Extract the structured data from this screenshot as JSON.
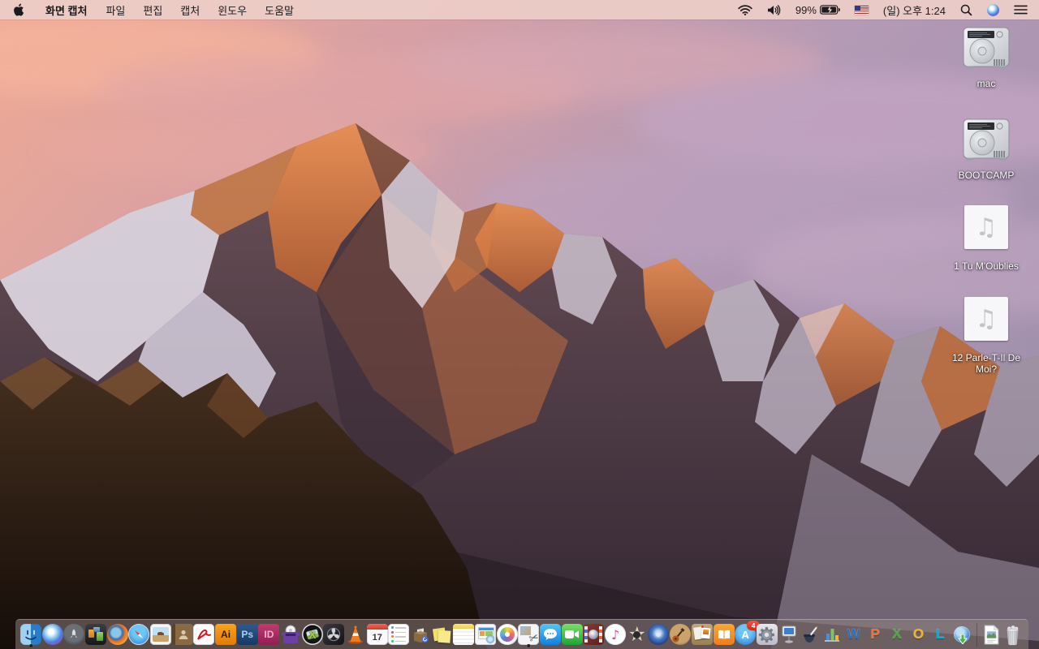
{
  "menu_bar": {
    "app_name": "화면 캡처",
    "menus": [
      "파일",
      "편집",
      "캡처",
      "윈도우",
      "도움말"
    ],
    "status": {
      "battery_percent": "99%",
      "clock": "(일) 오후 1:24",
      "icons": [
        "wifi-icon",
        "volume-icon",
        "battery-charging-icon",
        "us-flag-input-source-icon",
        "spotlight-search-icon",
        "siri-icon",
        "notification-center-icon"
      ]
    }
  },
  "desktop_icons": [
    {
      "kind": "hard-drive",
      "label": "mac"
    },
    {
      "kind": "hard-drive",
      "label": "BOOTCAMP"
    },
    {
      "kind": "audio-file",
      "label": "1 Tu M'Oublies"
    },
    {
      "kind": "audio-file",
      "label": "12 Parle-T-Il De Moi?"
    }
  ],
  "dock": {
    "apps": [
      {
        "icon": "finder-icon",
        "running": true
      },
      {
        "icon": "siri-icon"
      },
      {
        "icon": "launchpad-icon"
      },
      {
        "icon": "mission-control-icon"
      },
      {
        "icon": "firefox-icon"
      },
      {
        "icon": "safari-icon"
      },
      {
        "icon": "preview-icon"
      },
      {
        "icon": "contacts-book-icon"
      },
      {
        "icon": "acrobat-reader-icon"
      },
      {
        "icon": "illustrator-icon",
        "glyph": "Ai"
      },
      {
        "icon": "photoshop-icon",
        "glyph": "Ps"
      },
      {
        "icon": "indesign-icon",
        "glyph": "ID"
      },
      {
        "icon": "toast-burner-icon"
      },
      {
        "icon": "divx-icon",
        "glyph": "X"
      },
      {
        "icon": "disk-fan-utility-icon"
      },
      {
        "icon": "vlc-icon"
      },
      {
        "icon": "calendar-icon",
        "glyph": "17"
      },
      {
        "icon": "reminders-icon"
      },
      {
        "icon": "mail-crate-icon"
      },
      {
        "icon": "stickies-icon"
      },
      {
        "icon": "notes-icon"
      },
      {
        "icon": "iweb-icon"
      },
      {
        "icon": "photos-icon"
      },
      {
        "icon": "screen-capture-icon",
        "running": true
      },
      {
        "icon": "messages-icon"
      },
      {
        "icon": "facetime-icon"
      },
      {
        "icon": "photo-booth-icon"
      },
      {
        "icon": "itunes-icon",
        "glyph": "♪"
      },
      {
        "icon": "imovie-icon",
        "glyph": "★"
      },
      {
        "icon": "idvd-icon"
      },
      {
        "icon": "garageband-icon"
      },
      {
        "icon": "scrapbook-collage-icon"
      },
      {
        "icon": "ibooks-icon"
      },
      {
        "icon": "app-store-icon",
        "glyph": "A",
        "badge": "4"
      },
      {
        "icon": "system-preferences-icon"
      },
      {
        "icon": "keynote-icon"
      },
      {
        "icon": "pages-icon"
      },
      {
        "icon": "numbers-icon"
      },
      {
        "icon": "word-icon",
        "glyph": "W"
      },
      {
        "icon": "powerpoint-icon",
        "glyph": "P"
      },
      {
        "icon": "excel-icon",
        "glyph": "X"
      },
      {
        "icon": "outlook-icon",
        "glyph": "O"
      },
      {
        "icon": "lync-icon",
        "glyph": "L"
      },
      {
        "icon": "downloads-globe-icon"
      }
    ],
    "right_items": [
      {
        "icon": "image-document-icon"
      },
      {
        "icon": "trash-full-icon"
      }
    ]
  },
  "colors": {
    "menu_bar_bg": "#eccdc7",
    "dock_bg": "rgba(148,132,129,0.52)",
    "badge_red": "#e0301e",
    "sunlit_rock": "#e5823e",
    "sky_pink": "#efa993",
    "sky_purple": "#a291ae"
  }
}
